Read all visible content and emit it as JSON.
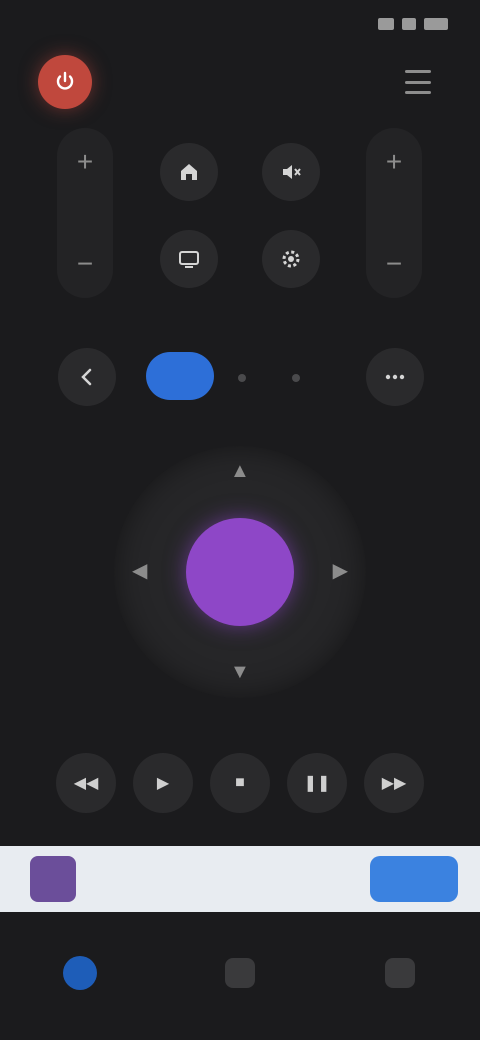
{
  "status": {
    "time": ""
  },
  "header": {
    "title": ""
  },
  "volume": {
    "plus": "+",
    "minus": "−",
    "label": ""
  },
  "channel": {
    "plus": "+",
    "minus": "−",
    "label": ""
  },
  "buttons": {
    "ok_label": ""
  },
  "dpad": {
    "up": "▲",
    "down": "▼",
    "left": "◀",
    "right": "▶"
  },
  "media": {
    "icons": [
      "◀◀",
      "▶",
      "■",
      "❚❚",
      "▶▶"
    ]
  },
  "banner": {
    "text": "",
    "cta": ""
  },
  "nav": [
    {
      "label": "",
      "active": true
    },
    {
      "label": "",
      "active": false
    },
    {
      "label": "",
      "active": false
    }
  ],
  "colors": {
    "power": "#c0483d",
    "accent": "#2d6fd8",
    "dpad_center": "#8e47c7"
  }
}
